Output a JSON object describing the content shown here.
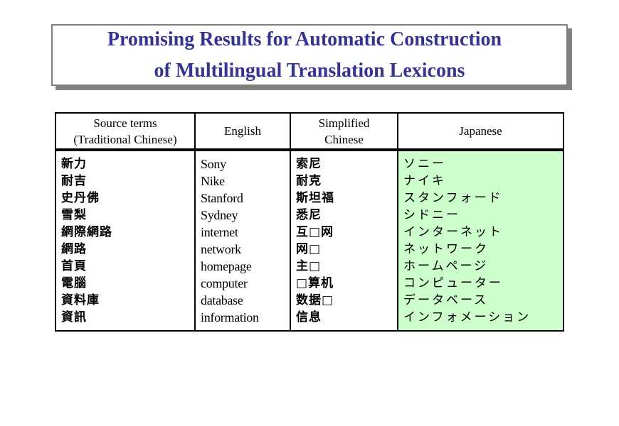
{
  "title": {
    "line1": "Promising Results for Automatic Construction",
    "line2": "of Multilingual Translation Lexicons",
    "color": "#333399"
  },
  "table": {
    "headers": {
      "source_line1": "Source terms",
      "source_line2": "(Traditional Chinese)",
      "english": "English",
      "simplified_line1": "Simplified",
      "simplified_line2": "Chinese",
      "japanese": "Japanese"
    },
    "japanese_column_color": "#ccffcc",
    "rows": [
      {
        "traditional": "新力",
        "english": "Sony",
        "simplified": "索尼",
        "japanese": "ソニー"
      },
      {
        "traditional": "耐吉",
        "english": "Nike",
        "simplified": "耐克",
        "japanese": "ナイキ"
      },
      {
        "traditional": "史丹佛",
        "english": "Stanford",
        "simplified": "斯坦福",
        "japanese": "スタンフォード"
      },
      {
        "traditional": "雪梨",
        "english": "Sydney",
        "simplified": "悉尼",
        "japanese": "シドニー"
      },
      {
        "traditional": "網際網路",
        "english": "internet",
        "simplified": "互□网",
        "japanese": "インターネット"
      },
      {
        "traditional": "網路",
        "english": "network",
        "simplified": "网□",
        "japanese": "ネットワーク"
      },
      {
        "traditional": "首頁",
        "english": "homepage",
        "simplified": "主□",
        "japanese": "ホームページ"
      },
      {
        "traditional": "電腦",
        "english": "computer",
        "simplified": "□算机",
        "japanese": "コンピューター"
      },
      {
        "traditional": "資料庫",
        "english": "database",
        "simplified": "数据□",
        "japanese": "データベース"
      },
      {
        "traditional": "資訊",
        "english": "information",
        "simplified": "信息",
        "japanese": "インフォメーション"
      }
    ]
  }
}
